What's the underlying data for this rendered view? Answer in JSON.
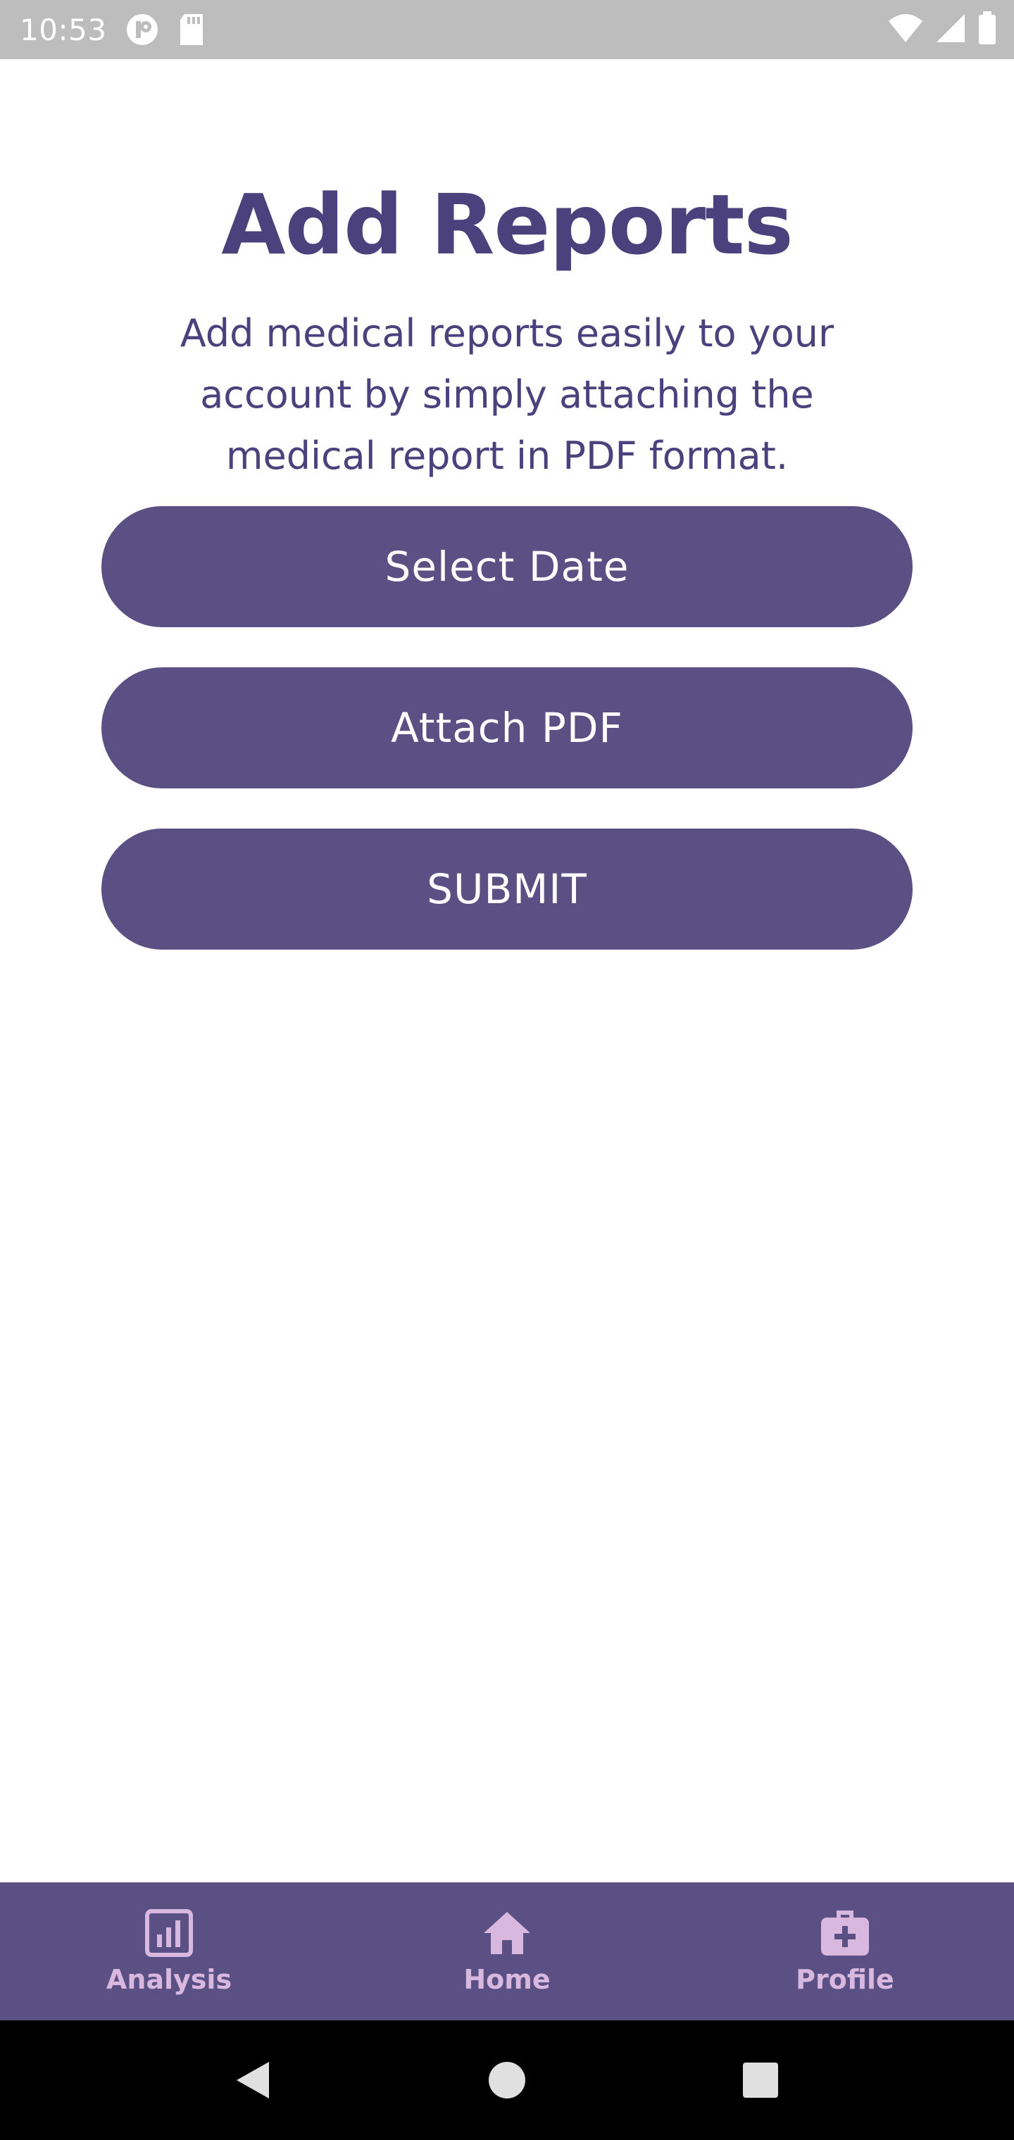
{
  "status_bar": {
    "time": "10:53",
    "left_icons": [
      "notification-app-icon",
      "sd-card-icon"
    ],
    "right_icons": [
      "wifi-icon",
      "cell-signal-icon",
      "battery-icon"
    ]
  },
  "main": {
    "title": "Add Reports",
    "subtitle": "Add medical reports easily to your account by simply attaching the medical report in PDF format.",
    "buttons": {
      "select_date": "Select Date",
      "attach_pdf": "Attach PDF",
      "submit": "SUBMIT"
    }
  },
  "bottom_nav": {
    "items": [
      {
        "label": "Analysis",
        "icon": "bar-chart-icon"
      },
      {
        "label": "Home",
        "icon": "home-icon"
      },
      {
        "label": "Profile",
        "icon": "medical-kit-icon"
      }
    ]
  },
  "system_nav": {
    "buttons": [
      "back-icon",
      "home-circle-icon",
      "recents-icon"
    ]
  },
  "colors": {
    "primary": "#5a5084",
    "title_text": "#4b417d",
    "nav_label": "#d9b8e0",
    "status_bar": "#bdbdbd"
  }
}
